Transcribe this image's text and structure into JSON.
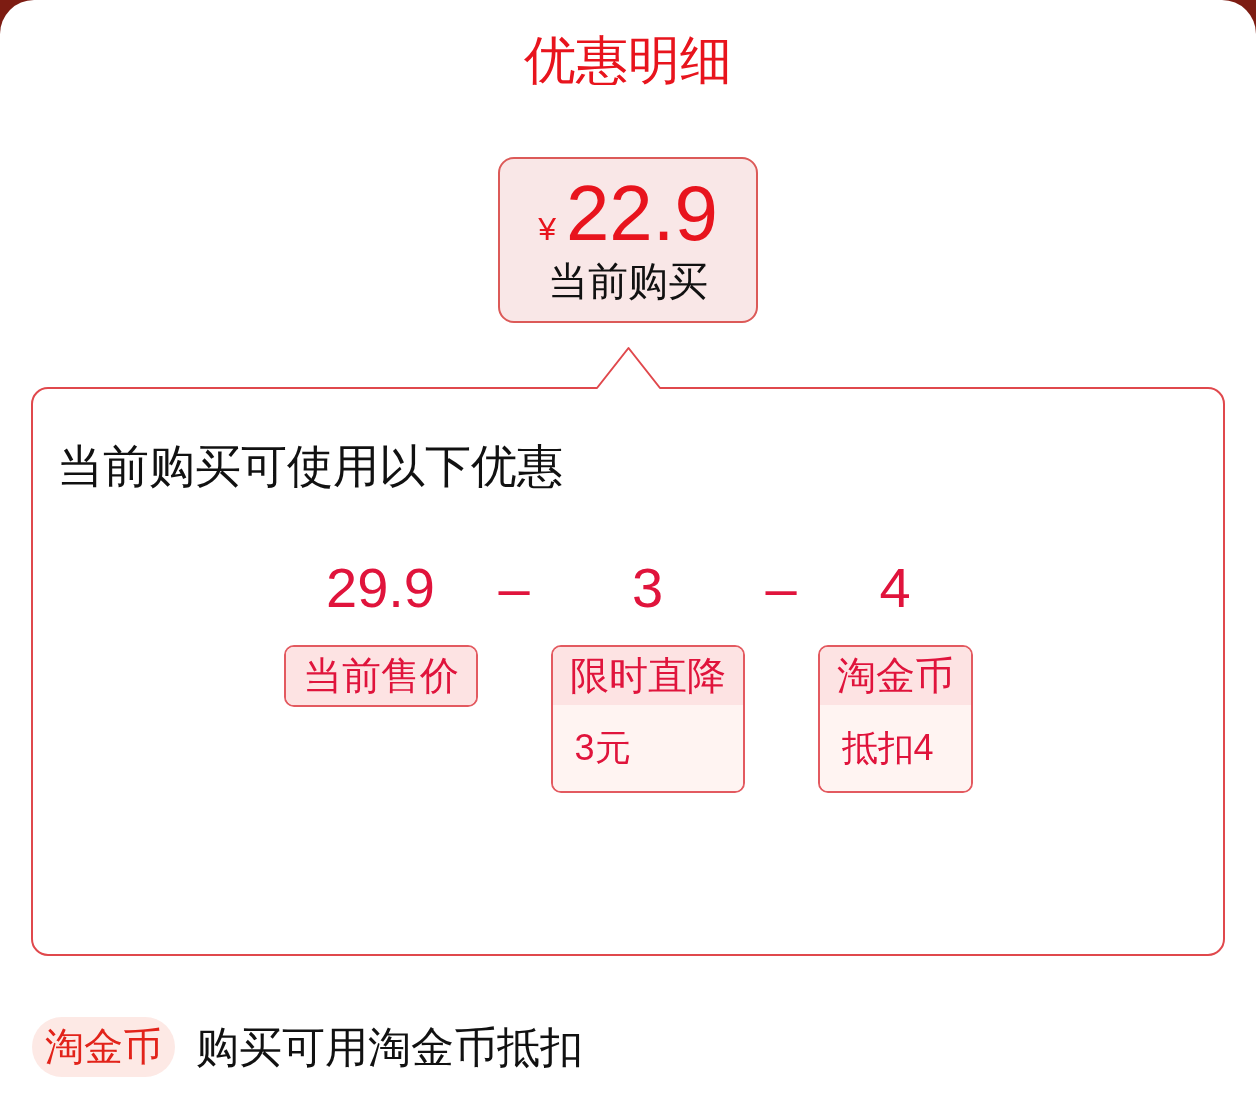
{
  "title": "优惠明细",
  "price_card": {
    "currency": "¥",
    "amount": "22.9",
    "label": "当前购买"
  },
  "discount_panel": {
    "heading": "当前购买可使用以下优惠",
    "formula": [
      {
        "kind": "amount",
        "value": "29.9",
        "tag": "当前售价"
      },
      {
        "kind": "operator",
        "symbol": "–"
      },
      {
        "kind": "amount",
        "value": "3",
        "tag": "限时直降",
        "detail": "3元"
      },
      {
        "kind": "operator",
        "symbol": "–"
      },
      {
        "kind": "amount",
        "value": "4",
        "tag": "淘金币",
        "detail": "抵扣4"
      }
    ]
  },
  "footer_note": {
    "badge": "淘金币",
    "text": "购买可用淘金币抵扣"
  }
}
